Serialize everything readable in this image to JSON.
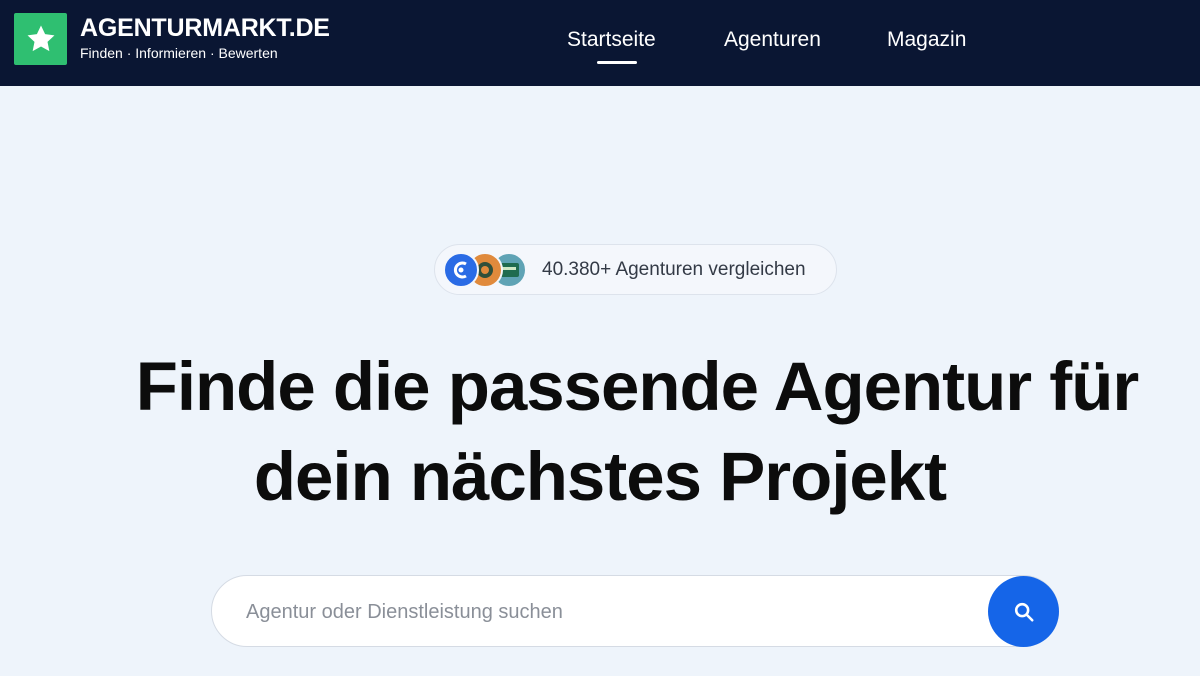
{
  "header": {
    "logo_title": "AGENTURMARKT.DE",
    "logo_tagline": "Finden · Informieren · Bewerten",
    "logo_icon": "star-icon",
    "nav": [
      {
        "label": "Startseite",
        "active": true
      },
      {
        "label": "Agenturen",
        "active": false
      },
      {
        "label": "Magazin",
        "active": false
      }
    ]
  },
  "hero": {
    "badge_text": "40.380+ Agenturen vergleichen",
    "headline_line1": "Finde die passende Agentur für",
    "headline_line2": "dein nächstes Projekt"
  },
  "search": {
    "placeholder": "Agentur oder Dienstleistung suchen",
    "value": "",
    "button_icon": "search-icon"
  },
  "colors": {
    "navbar": "#0a1633",
    "brand_green": "#2fbf71",
    "accent_blue": "#1565e8",
    "page_bg": "#eef4fb"
  }
}
